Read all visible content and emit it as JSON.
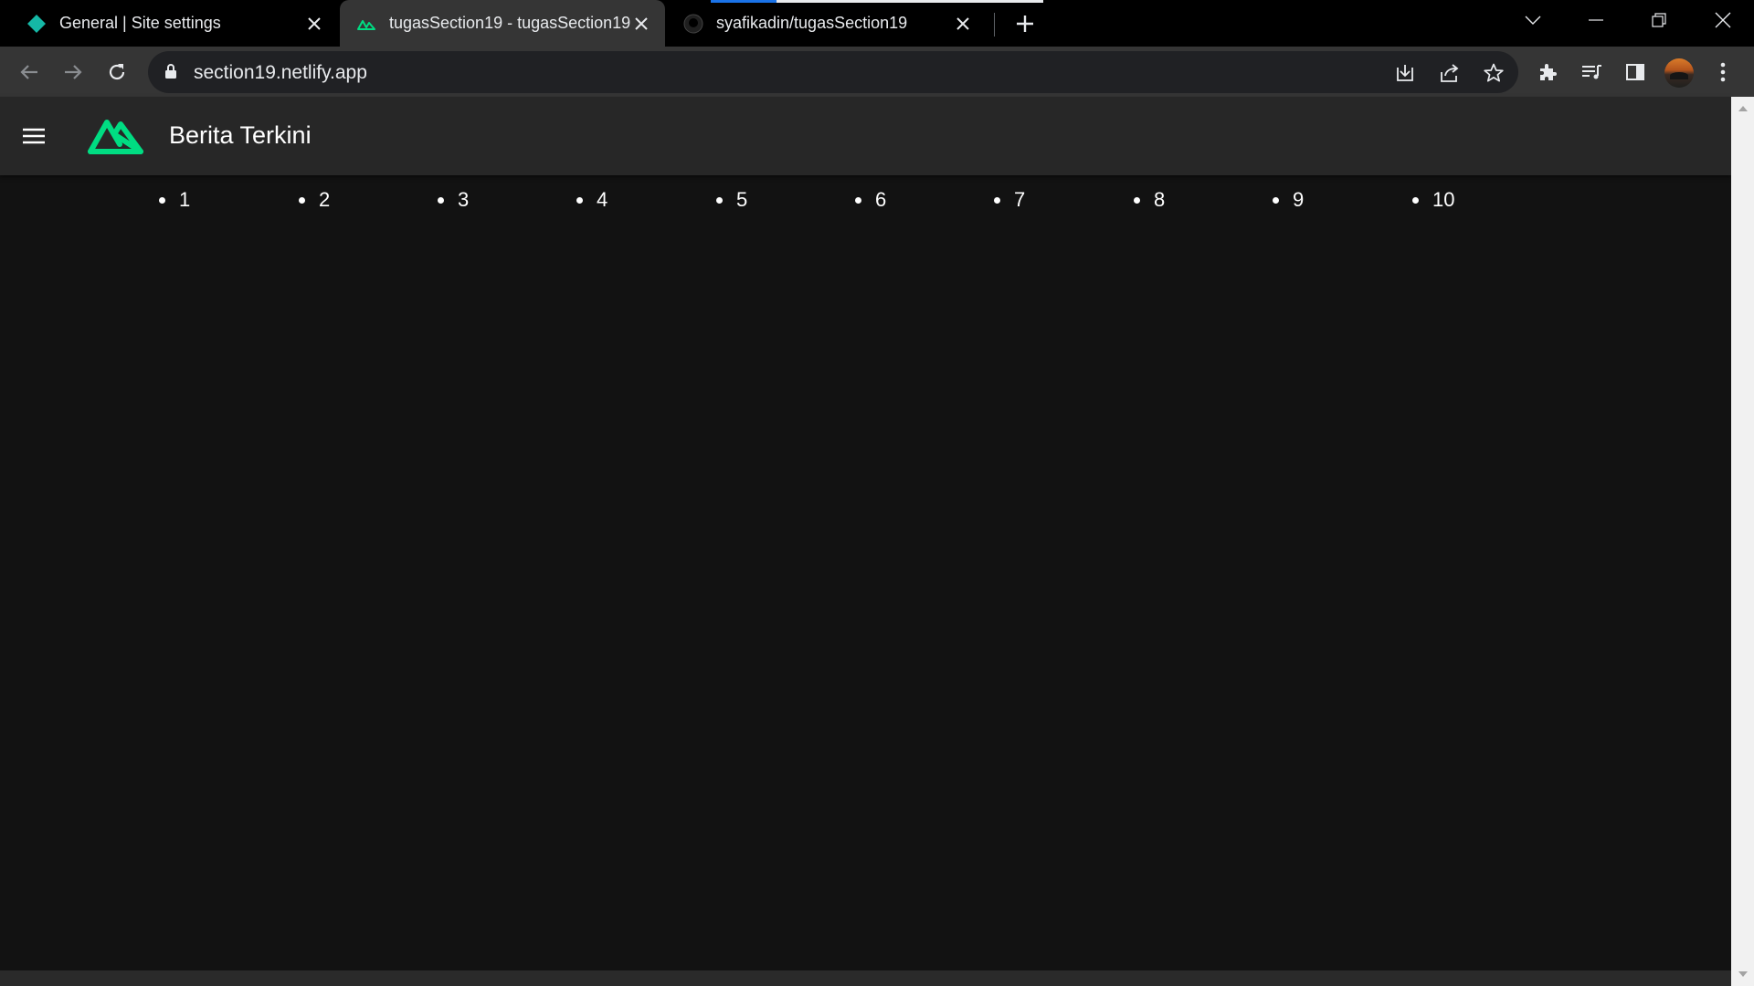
{
  "browser": {
    "tabs": [
      {
        "title": "General | Site settings",
        "icon": "netlify-diamond-icon"
      },
      {
        "title": "tugasSection19 - tugasSection19",
        "icon": "nuxt-icon",
        "active": true
      },
      {
        "title": "syafikadin/tugasSection19",
        "icon": "github-icon"
      }
    ],
    "address": {
      "url": "section19.netlify.app"
    }
  },
  "page": {
    "title": "Berita Terkini",
    "pagination": [
      "1",
      "2",
      "3",
      "4",
      "5",
      "6",
      "7",
      "8",
      "9",
      "10"
    ]
  },
  "colors": {
    "brand_green": "#00dc82",
    "app_bar": "#272727",
    "background": "#121212"
  }
}
